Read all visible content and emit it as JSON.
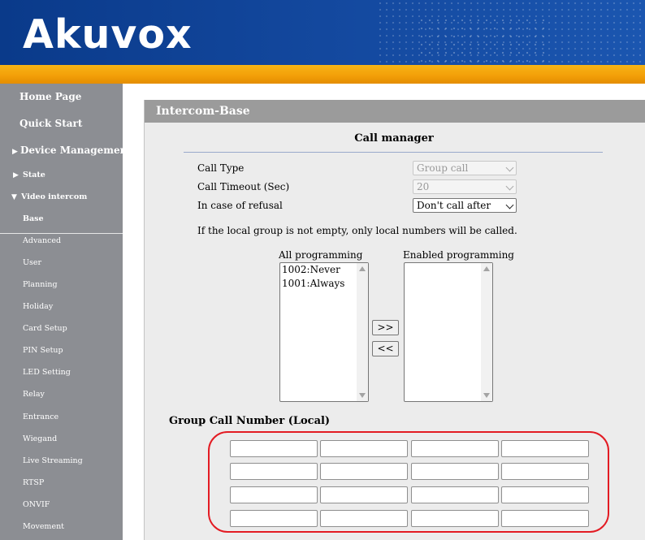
{
  "brand": {
    "logo_text": "Akuvox"
  },
  "sidebar": {
    "items": [
      {
        "label": "Home Page"
      },
      {
        "label": "Quick Start"
      },
      {
        "label": "Device Management"
      },
      {
        "label": "State"
      },
      {
        "label": "Video intercom"
      },
      {
        "label": "Base"
      },
      {
        "label": "Advanced"
      },
      {
        "label": "User"
      },
      {
        "label": "Planning"
      },
      {
        "label": "Holiday"
      },
      {
        "label": "Card Setup"
      },
      {
        "label": "PIN Setup"
      },
      {
        "label": "LED Setting"
      },
      {
        "label": "Relay"
      },
      {
        "label": "Entrance"
      },
      {
        "label": "Wiegand"
      },
      {
        "label": "Live Streaming"
      },
      {
        "label": "RTSP"
      },
      {
        "label": "ONVIF"
      },
      {
        "label": "Movement"
      }
    ]
  },
  "panel": {
    "title": "Intercom-Base",
    "section_title": "Call manager",
    "fields": [
      {
        "label": "Call Type",
        "value": "Group call",
        "disabled": true
      },
      {
        "label": "Call Timeout (Sec)",
        "value": "20",
        "disabled": true
      },
      {
        "label": "In case of refusal",
        "value": "Don't call after",
        "disabled": false
      }
    ],
    "info_text": "If the local group is not empty, only local numbers will be called.",
    "all_programming": {
      "label": "All programming",
      "items": [
        "1002:Never",
        "1001:Always"
      ]
    },
    "enabled_programming": {
      "label": "Enabled programming",
      "items": []
    },
    "buttons": {
      "add": ">>",
      "remove": "<<"
    },
    "group_call_title": "Group Call Number (Local)",
    "group_numbers": [
      [
        "",
        "",
        "",
        ""
      ],
      [
        "",
        "",
        "",
        ""
      ],
      [
        "",
        "",
        "",
        ""
      ],
      [
        "",
        "",
        "",
        ""
      ]
    ],
    "highlight_color": "#e31b23"
  },
  "colors": {
    "banner_blue": "#13489e",
    "accent_orange": "#f3a009",
    "sidebar_gray": "#8c8e93"
  }
}
